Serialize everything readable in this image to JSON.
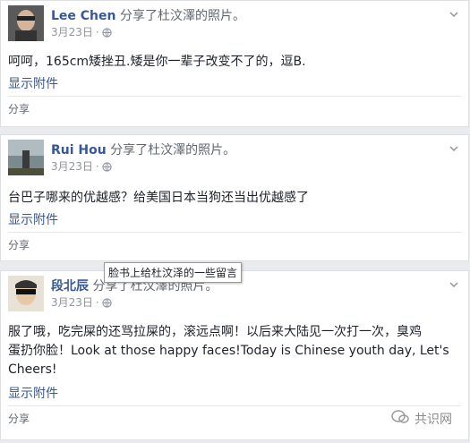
{
  "posts": [
    {
      "author": "Lee Chen",
      "action": "分享了杜汶澤的照片。",
      "date": "3月23日",
      "dot": "·",
      "text": "呵呵，165cm矮挫丑.矮是你一辈子改变不了的，逗B.",
      "attachment_link": "显示附件",
      "share_label": "分享"
    },
    {
      "author": "Rui Hou",
      "action": "分享了杜汶澤的照片。",
      "date": "3月23日",
      "dot": "·",
      "text": "台巴子哪来的优越感？给美国日本当狗还当出优越感了",
      "attachment_link": "显示附件",
      "share_label": "分享"
    },
    {
      "author": "段北辰",
      "action": "分享了杜汶澤的照片。",
      "date": "3月23日",
      "dot": "·",
      "text_line1": "服了哦，吃完屎的还骂拉屎的，滚远点啊！以后来大陆见一次打一次，臭鸡",
      "text_line2": "蛋扔你脸！Look at those happy faces!Today is Chinese youth day, Let's",
      "text_line3": "Cheers!",
      "attachment_link": "显示附件",
      "share_label": "分享"
    }
  ],
  "tooltip": "脸书上给杜汶泽的一些留言",
  "watermark": "共识网",
  "icons": [
    "globe-icon",
    "chevron-down-icon",
    "avatar",
    "watermark-logo-icon"
  ]
}
